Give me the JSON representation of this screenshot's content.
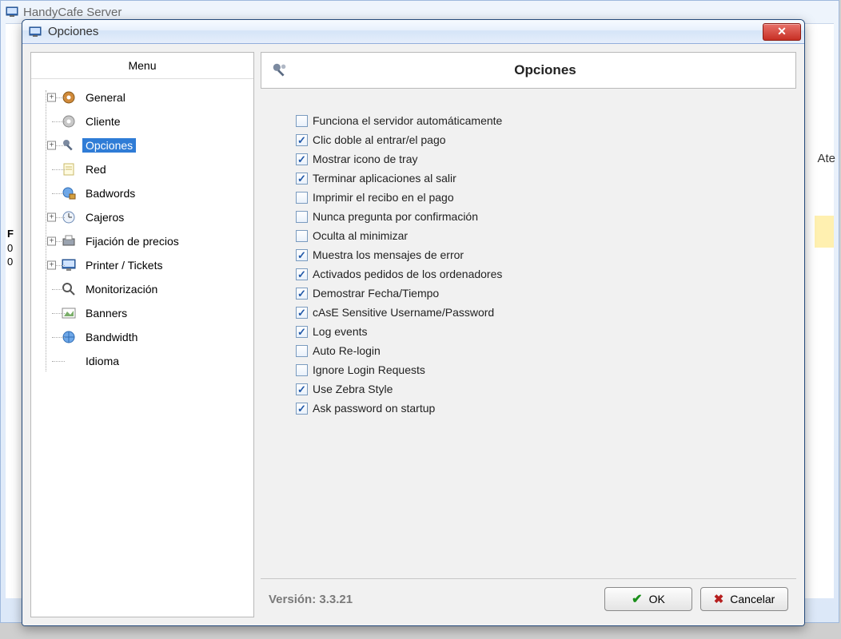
{
  "background_window": {
    "title": "HandyCafe Server",
    "right_label": "Ate",
    "col_p": "F",
    "col_0a": "0",
    "col_0b": "0"
  },
  "dialog": {
    "title": "Opciones",
    "menu_header": "Menu",
    "tree": [
      {
        "label": "General",
        "icon": "gear-color-icon",
        "expandable": true
      },
      {
        "label": "Cliente",
        "icon": "gear-icon",
        "expandable": false
      },
      {
        "label": "Opciones",
        "icon": "tools-icon",
        "expandable": true,
        "selected": true
      },
      {
        "label": "Red",
        "icon": "note-icon",
        "expandable": false
      },
      {
        "label": "Badwords",
        "icon": "globe-lock-icon",
        "expandable": false
      },
      {
        "label": "Cajeros",
        "icon": "clock-icon",
        "expandable": true
      },
      {
        "label": "Fijación de precios",
        "icon": "printer-icon",
        "expandable": true
      },
      {
        "label": "Printer / Tickets",
        "icon": "monitor-icon",
        "expandable": true
      },
      {
        "label": "Monitorización",
        "icon": "lens-icon",
        "expandable": false
      },
      {
        "label": "Banners",
        "icon": "picture-icon",
        "expandable": false
      },
      {
        "label": "Bandwidth",
        "icon": "globe-icon",
        "expandable": false
      },
      {
        "label": "Idioma",
        "icon": "blank-icon",
        "expandable": false
      }
    ],
    "content_title": "Opciones",
    "options": [
      {
        "checked": false,
        "label": "Funciona el servidor automáticamente"
      },
      {
        "checked": true,
        "label": "Clic doble al entrar/el pago"
      },
      {
        "checked": true,
        "label": "Mostrar icono de tray"
      },
      {
        "checked": true,
        "label": "Terminar aplicaciones al salir"
      },
      {
        "checked": false,
        "label": "Imprimir el recibo en el pago"
      },
      {
        "checked": false,
        "label": "Nunca pregunta por confirmación"
      },
      {
        "checked": false,
        "label": "Oculta al minimizar"
      },
      {
        "checked": true,
        "label": "Muestra los mensajes de error"
      },
      {
        "checked": true,
        "label": "Activados pedidos de los ordenadores"
      },
      {
        "checked": true,
        "label": "Demostrar Fecha/Tiempo"
      },
      {
        "checked": true,
        "label": "cAsE Sensitive Username/Password"
      },
      {
        "checked": true,
        "label": "Log events"
      },
      {
        "checked": false,
        "label": "Auto Re-login"
      },
      {
        "checked": false,
        "label": "Ignore Login Requests"
      },
      {
        "checked": true,
        "label": "Use Zebra Style"
      },
      {
        "checked": true,
        "label": "Ask password on startup"
      }
    ],
    "version_label": "Versión: 3.3.21",
    "ok_label": "OK",
    "cancel_label": "Cancelar"
  }
}
